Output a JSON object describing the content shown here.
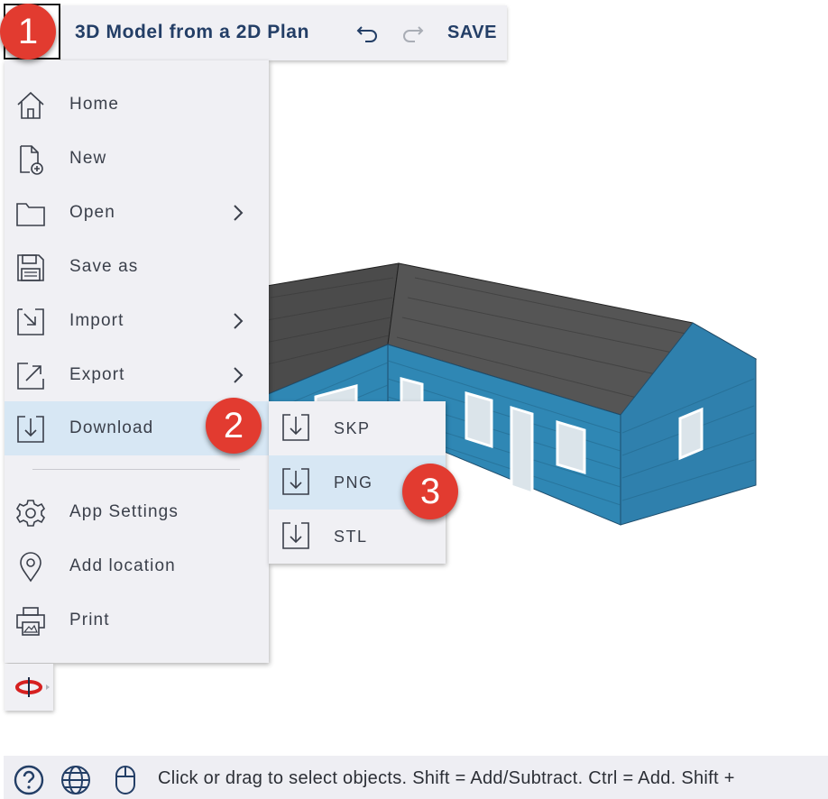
{
  "header": {
    "title": "3D Model from a 2D Plan",
    "save_label": "SAVE"
  },
  "main_menu": {
    "items": [
      {
        "label": "Home",
        "icon": "home-icon"
      },
      {
        "label": "New",
        "icon": "new-file-icon"
      },
      {
        "label": "Open",
        "icon": "folder-icon",
        "has_submenu": true
      },
      {
        "label": "Save as",
        "icon": "floppy-disk-icon"
      },
      {
        "label": "Import",
        "icon": "import-arrow-icon",
        "has_submenu": true
      },
      {
        "label": "Export",
        "icon": "export-arrow-icon",
        "has_submenu": true
      },
      {
        "label": "Download",
        "icon": "download-icon",
        "active": true
      },
      {
        "label": "App Settings",
        "icon": "gear-icon"
      },
      {
        "label": "Add location",
        "icon": "location-pin-icon"
      },
      {
        "label": "Print",
        "icon": "printer-icon"
      }
    ]
  },
  "download_submenu": {
    "items": [
      {
        "label": "SKP",
        "icon": "download-icon"
      },
      {
        "label": "PNG",
        "icon": "download-icon",
        "active": true
      },
      {
        "label": "STL",
        "icon": "download-icon"
      }
    ]
  },
  "badges": [
    "1",
    "2",
    "3"
  ],
  "status_bar": {
    "message": "Click or drag to select objects. Shift = Add/Subtract. Ctrl = Add. Shift +"
  },
  "colors": {
    "accent_text": "#233e66",
    "menu_bg": "#f0f0f4",
    "active_bg": "#d7e7f4",
    "badge": "#e23b30",
    "siding": "#2f87b4",
    "roof": "#4a4a4a"
  }
}
